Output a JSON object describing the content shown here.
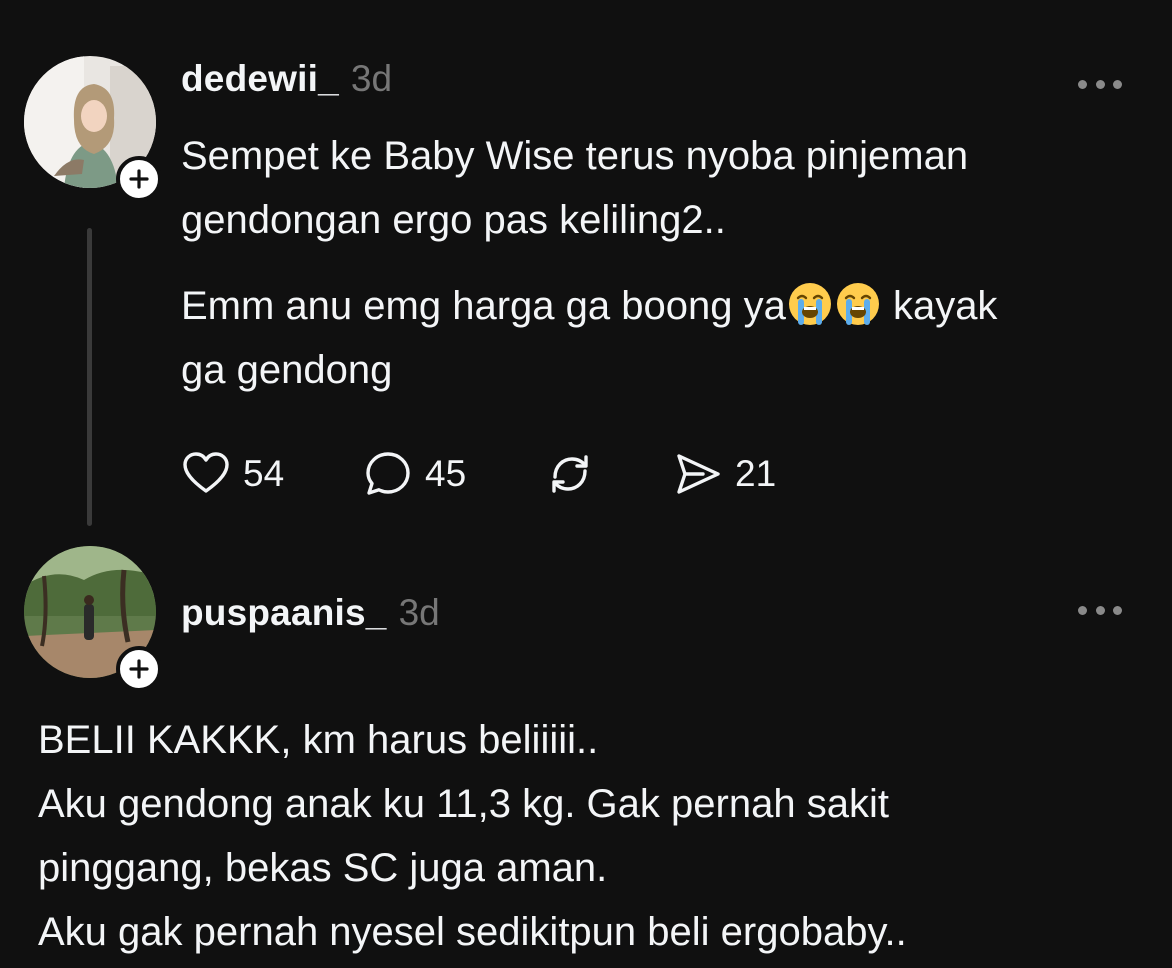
{
  "posts": [
    {
      "username": "dedewii_",
      "timestamp": "3d",
      "avatar_icon": "user-avatar-photo",
      "paragraph_1": "Sempet ke Baby Wise terus nyoba pinjeman\ngendongan ergo pas keliling2..",
      "paragraph_2_before": "Emm anu emg harga ga boong ya",
      "paragraph_2_emojis": [
        "loudly-crying-face-emoji",
        "loudly-crying-face-emoji"
      ],
      "paragraph_2_after": " kayak\nga gendong",
      "actions": {
        "likes": "54",
        "replies": "45",
        "shares": "21"
      }
    },
    {
      "username": "puspaanis_",
      "timestamp": "3d",
      "avatar_icon": "user-avatar-photo",
      "text": "BELII KAKKK, km harus beliiiii..\nAku gendong anak ku 11,3 kg. Gak pernah sakit\npinggang, bekas SC juga aman.\nAku gak pernah nyesel sedikitpun beli ergobaby.."
    }
  ],
  "colors": {
    "background": "#101010",
    "text": "#f3f5f7",
    "muted": "#777777",
    "thread_line": "#3a3a3a"
  }
}
